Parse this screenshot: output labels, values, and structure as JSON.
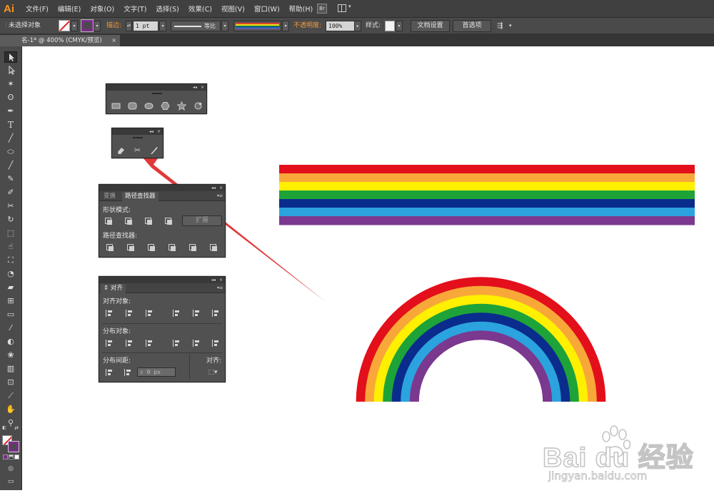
{
  "app": {
    "logo": "Ai"
  },
  "menu": [
    "文件(F)",
    "编辑(E)",
    "对象(O)",
    "文字(T)",
    "选择(S)",
    "效果(C)",
    "视图(V)",
    "窗口(W)",
    "帮助(H)"
  ],
  "menubar_icons": {
    "bridge": "Br",
    "layout": "workspace-layout-icon"
  },
  "control_bar": {
    "selection_status": "未选择对象",
    "stroke_label": "描边:",
    "stroke_weight": "1 pt",
    "stroke_profile": "等比",
    "opacity_label": "不透明度:",
    "opacity_value": "100%",
    "style_label": "样式:",
    "doc_setup_button": "文档设置",
    "preferences_button": "首选项",
    "colors": {
      "accent_label": "#f29b3d",
      "fill": "#ffffff",
      "stroke": "#7b2c8a"
    }
  },
  "document_tab": {
    "title": "名-1* @ 400% (CMYK/预览)",
    "close": "×"
  },
  "tools": [
    "selection-tool",
    "direct-selection-tool",
    "magic-wand-tool",
    "lasso-tool",
    "pen-tool",
    "type-tool",
    "line-tool",
    "ellipse-tool",
    "paintbrush-tool",
    "pencil-tool",
    "blob-brush-tool",
    "scissors-tool",
    "rotate-tool",
    "scale-tool",
    "warp-tool",
    "free-transform-tool",
    "shape-builder-tool",
    "perspective-grid-tool",
    "mesh-tool",
    "gradient-tool",
    "eyedropper-tool",
    "blend-tool",
    "symbol-sprayer-tool",
    "column-graph-tool",
    "artboard-tool",
    "slice-tool",
    "hand-tool",
    "zoom-tool"
  ],
  "panels": {
    "shapes": {
      "collapse": "◂◂",
      "close": "×",
      "icons": [
        "rectangle-icon",
        "rounded-rectangle-icon",
        "ellipse-icon",
        "polygon-icon",
        "star-icon",
        "flare-icon"
      ]
    },
    "cut": {
      "collapse": "◂◂",
      "close": "×",
      "icons": [
        "eraser-icon",
        "scissors-icon",
        "knife-icon"
      ]
    },
    "pathfinder": {
      "collapse": "◂◂",
      "close": "×",
      "tabs": [
        "变换",
        "路径查找器"
      ],
      "shape_modes_label": "形状模式:",
      "expand_button": "扩展",
      "pathfinders_label": "路径查找器:"
    },
    "align": {
      "collapse": "◂◂",
      "close": "×",
      "tab": "对齐",
      "align_objects_label": "对齐对象:",
      "distribute_objects_label": "分布对象:",
      "distribute_spacing_label": "分布间距:",
      "spacing_value": "0 px",
      "align_to_label": "对齐:"
    }
  },
  "artwork": {
    "stripe_colors": [
      "#e30f1b",
      "#f8a838",
      "#fff000",
      "#1ea339",
      "#0a2c8c",
      "#2ba3de",
      "#7b388f"
    ]
  },
  "watermark": {
    "brand": "Bai du 经验",
    "url": "jingyan.baidu.com"
  }
}
